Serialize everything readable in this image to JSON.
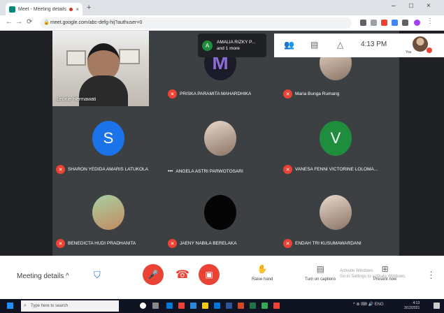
{
  "browser": {
    "tab_title": "Meet - Meeting details",
    "new_tab_symbol": "+",
    "close_symbol": "×",
    "url": "meet.google.com/abc-defg-hij?authuser=0",
    "window_controls": [
      "–",
      "□",
      "×"
    ],
    "nav_symbols": [
      "←",
      "→",
      "⟳"
    ]
  },
  "meet": {
    "presenter": {
      "name": "Leonie Hermawati"
    },
    "participants": [
      {
        "name": "PRISKA PARAMITA MAHARDHIKA",
        "avatar_type": "photo",
        "avatar_letter": "",
        "avatar_color": "#6a3fa0",
        "muted": true,
        "pinned": false
      },
      {
        "name": "Maria Bunga Rumang",
        "avatar_type": "photo2",
        "avatar_letter": "",
        "avatar_color": "#c9b8a6",
        "muted": true,
        "pinned": false
      },
      {
        "name": "SHARON YEDIDA AMARIS LATUKOLA",
        "avatar_type": "letter",
        "avatar_letter": "S",
        "avatar_color": "#1a73e8",
        "muted": true,
        "pinned": false
      },
      {
        "name": "ANGELA ASTRI PARWOTOSARI",
        "avatar_type": "photo2",
        "avatar_letter": "",
        "avatar_color": "#e8d8cc",
        "muted": false,
        "pinned": true
      },
      {
        "name": "VANESA FENNI VICTORINE LOLOMA...",
        "avatar_type": "letter",
        "avatar_letter": "V",
        "avatar_color": "#1e8e3e",
        "muted": true,
        "pinned": false
      },
      {
        "name": "BENEDICTA HUDI PRADHANITA",
        "avatar_type": "photo",
        "avatar_letter": "",
        "avatar_color": "#8ab58f",
        "muted": true,
        "pinned": false
      },
      {
        "name": "JAENY NABILA BERELAKA",
        "avatar_type": "dark",
        "avatar_letter": "",
        "avatar_color": "#050505",
        "muted": true,
        "pinned": false
      },
      {
        "name": "ENDAH TRI KUSUMAWARDANI",
        "avatar_type": "photo2",
        "avatar_letter": "",
        "avatar_color": "#d7c3b3",
        "muted": true,
        "pinned": false
      }
    ],
    "popup": {
      "avatar_letter": "A",
      "name": "AMALIA RIZKY P...",
      "more": "and 1 more"
    },
    "topbar": {
      "time": "4:13 PM",
      "you_label": "You"
    },
    "bottom": {
      "details_label": "Meeting details",
      "details_chevron": "^",
      "raise_hand_label": "Raise hand",
      "captions_label": "Turn on captions",
      "present_label": "Present now",
      "watermark_line1": "Activate Windows",
      "watermark_line2": "Go to Settings to activate Windows."
    }
  },
  "taskbar": {
    "search_placeholder": "Type here to search",
    "tray_text": "^ ⊕ ⌨ 🔊 ENG",
    "clock_time": "4:13",
    "clock_date": "3/12/2021"
  }
}
